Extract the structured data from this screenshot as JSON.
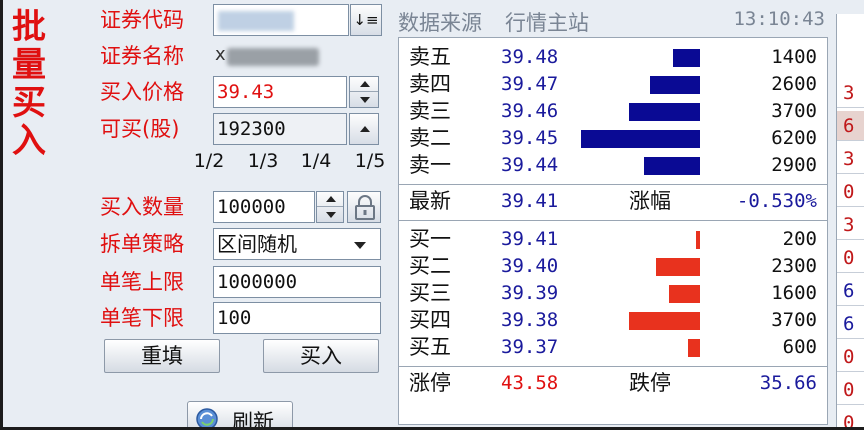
{
  "title": [
    "批",
    "量",
    "买",
    "入"
  ],
  "form": {
    "code_label": "证券代码",
    "name_label": "证券名称",
    "price_label": "买入价格",
    "price_value": "39.43",
    "avail_label": "可买(股)",
    "avail_value": "192300",
    "fractions": [
      "1/2",
      "1/3",
      "1/4",
      "1/5"
    ],
    "qty_label": "买入数量",
    "qty_value": "100000",
    "strategy_label": "拆单策略",
    "strategy_value": "区间随机",
    "upper_label": "单笔上限",
    "upper_value": "1000000",
    "lower_label": "单笔下限",
    "lower_value": "100",
    "reset_button": "重填",
    "buy_button": "买入",
    "refresh_button": "刷新",
    "sort_glyph": "↓≡",
    "name_visible_char": "ⅹ"
  },
  "header": {
    "source_label": "数据来源",
    "source_value": "行情主站",
    "time": "13:10:43"
  },
  "quote": {
    "sell": [
      {
        "name": "卖五",
        "price": "39.48",
        "volume": "1400",
        "amount": 1400
      },
      {
        "name": "卖四",
        "price": "39.47",
        "volume": "2600",
        "amount": 2600
      },
      {
        "name": "卖三",
        "price": "39.46",
        "volume": "3700",
        "amount": 3700
      },
      {
        "name": "卖二",
        "price": "39.45",
        "volume": "6200",
        "amount": 6200
      },
      {
        "name": "卖一",
        "price": "39.44",
        "volume": "2900",
        "amount": 2900
      }
    ],
    "latest_label": "最新",
    "latest_value": "39.41",
    "change_label": "涨幅",
    "change_value": "-0.530%",
    "buy": [
      {
        "name": "买一",
        "price": "39.41",
        "volume": "200",
        "amount": 200
      },
      {
        "name": "买二",
        "price": "39.40",
        "volume": "2300",
        "amount": 2300
      },
      {
        "name": "买三",
        "price": "39.39",
        "volume": "1600",
        "amount": 1600
      },
      {
        "name": "买四",
        "price": "39.38",
        "volume": "3700",
        "amount": 3700
      },
      {
        "name": "买五",
        "price": "39.37",
        "volume": "600",
        "amount": 600
      }
    ],
    "limit_up_label": "涨停",
    "limit_up_value": "43.58",
    "limit_down_label": "跌停",
    "limit_down_value": "35.66"
  },
  "side_column": [
    {
      "text": "3",
      "color": "#c0181a"
    },
    {
      "text": "6",
      "color": "#c0181a"
    },
    {
      "text": "3",
      "color": "#c0181a"
    },
    {
      "text": "0",
      "color": "#c0181a"
    },
    {
      "text": "3",
      "color": "#c0181a"
    },
    {
      "text": "0",
      "color": "#c0181a"
    },
    {
      "text": "6",
      "color": "#1a1a9c"
    },
    {
      "text": "6",
      "color": "#1a1a9c"
    },
    {
      "text": "0",
      "color": "#c0181a"
    },
    {
      "text": "0",
      "color": "#c0181a"
    },
    {
      "text": "0",
      "color": "#c0181a"
    }
  ],
  "colors": {
    "label_red": "#e01010",
    "price_blue": "#1a1a9c",
    "sell_bar": "#0a0a94",
    "buy_bar": "#e8321e"
  }
}
